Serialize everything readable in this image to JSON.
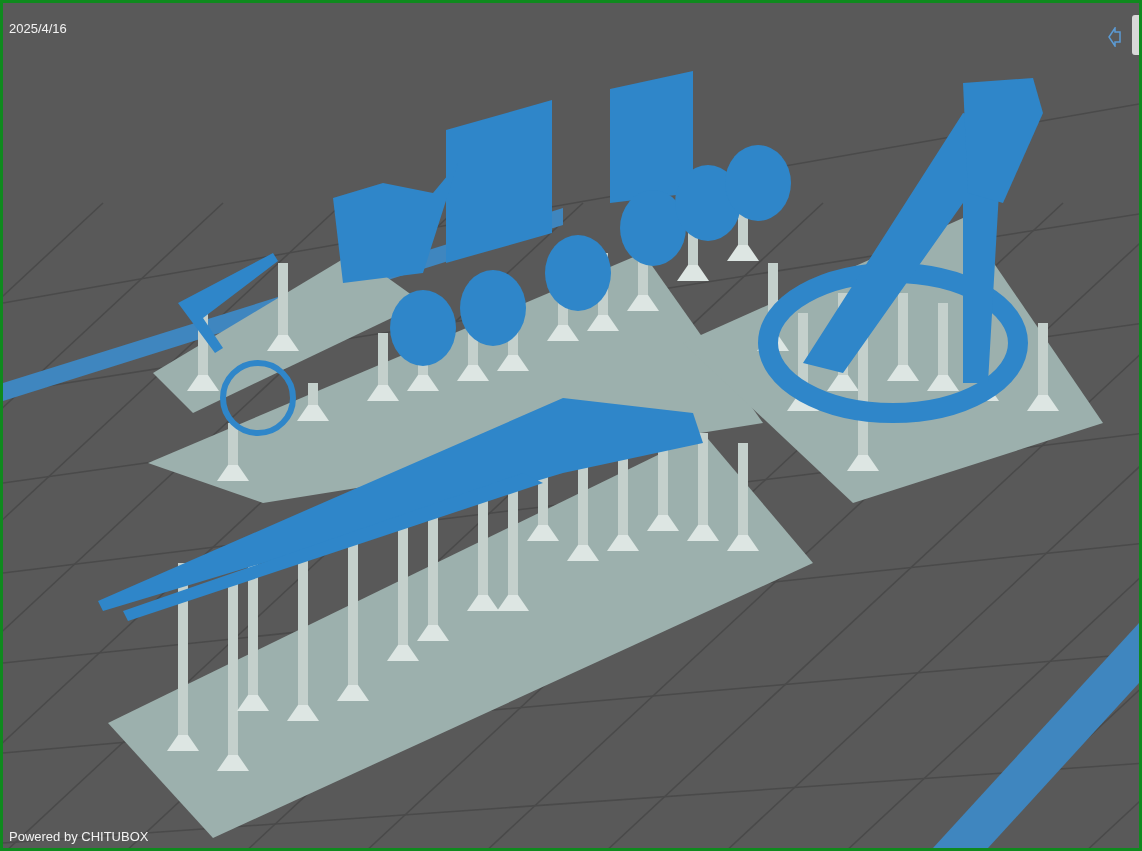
{
  "viewport": {
    "date": "2025/4/16",
    "footer": "Powered by CHITUBOX"
  }
}
